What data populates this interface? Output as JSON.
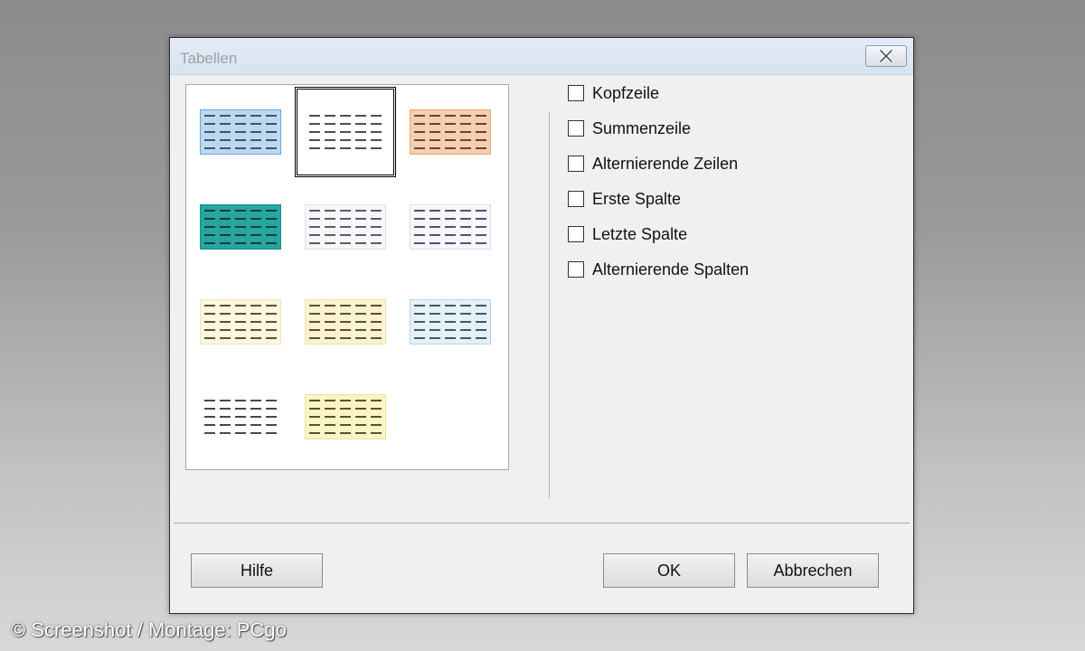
{
  "dialog": {
    "title": "Tabellen",
    "close_icon": "close-icon"
  },
  "styles": [
    {
      "id": "blue",
      "border": "#6ea7d8",
      "fill": "#bcd8f1",
      "line": "#20324a",
      "selected": false
    },
    {
      "id": "plain",
      "border": "#ffffff",
      "fill": "#ffffff",
      "line": "#222222",
      "selected": true
    },
    {
      "id": "orange",
      "border": "#e7a676",
      "fill": "#f6cfb0",
      "line": "#3a2418",
      "selected": false
    },
    {
      "id": "teal",
      "border": "#118f8f",
      "fill": "#27a6a0",
      "line": "#0d2222",
      "selected": false
    },
    {
      "id": "light-gray",
      "border": "#dde1e6",
      "fill": "#f6f7f9",
      "line": "#333842",
      "selected": false
    },
    {
      "id": "lavender",
      "border": "#dcdcf0",
      "fill": "#f6f6fd",
      "line": "#2b2b48",
      "selected": false
    },
    {
      "id": "cream",
      "border": "#efe6b8",
      "fill": "#fdf8dd",
      "line": "#2e2a10",
      "selected": false
    },
    {
      "id": "light-yellow",
      "border": "#efe1ae",
      "fill": "#fcf2cf",
      "line": "#2e2a10",
      "selected": false
    },
    {
      "id": "light-blue",
      "border": "#b7d6e6",
      "fill": "#e4f1f8",
      "line": "#1c3340",
      "selected": false
    },
    {
      "id": "white-black",
      "border": "#ffffff",
      "fill": "#ffffff",
      "line": "#1a1a1a",
      "selected": false
    },
    {
      "id": "yellow",
      "border": "#ece0a0",
      "fill": "#fdf4c6",
      "line": "#2e2a10",
      "selected": false
    }
  ],
  "options": [
    {
      "label": "Kopfzeile",
      "checked": false
    },
    {
      "label": "Summenzeile",
      "checked": false
    },
    {
      "label": "Alternierende Zeilen",
      "checked": false
    },
    {
      "label": "Erste Spalte",
      "checked": false
    },
    {
      "label": "Letzte Spalte",
      "checked": false
    },
    {
      "label": "Alternierende Spalten",
      "checked": false
    }
  ],
  "buttons": {
    "help": "Hilfe",
    "ok": "OK",
    "cancel": "Abbrechen"
  },
  "watermark": "© Screenshot / Montage: PCgo"
}
